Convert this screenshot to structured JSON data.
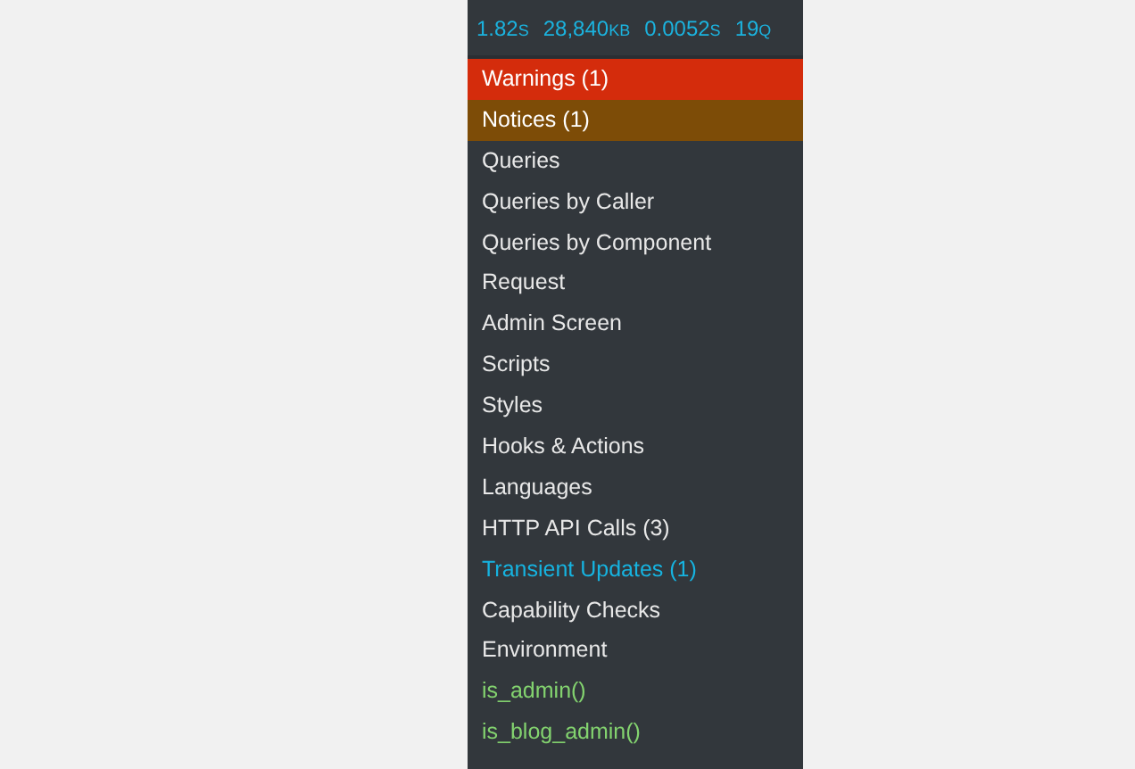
{
  "stats": [
    {
      "value": "1.82",
      "unit": "S"
    },
    {
      "value": "28,840",
      "unit": "KB"
    },
    {
      "value": "0.0052",
      "unit": "S"
    },
    {
      "value": "19",
      "unit": "Q"
    }
  ],
  "menu": [
    {
      "label": "Warnings (1)",
      "kind": "warning"
    },
    {
      "label": "Notices (1)",
      "kind": "notice"
    },
    {
      "label": "Queries",
      "kind": "normal"
    },
    {
      "label": "Queries by Caller",
      "kind": "normal"
    },
    {
      "label": "Queries by Component",
      "kind": "normal"
    },
    {
      "label": "Request",
      "kind": "normal"
    },
    {
      "label": "Admin Screen",
      "kind": "normal"
    },
    {
      "label": "Scripts",
      "kind": "normal"
    },
    {
      "label": "Styles",
      "kind": "normal"
    },
    {
      "label": "Hooks & Actions",
      "kind": "normal"
    },
    {
      "label": "Languages",
      "kind": "normal"
    },
    {
      "label": "HTTP API Calls (3)",
      "kind": "normal"
    },
    {
      "label": "Transient Updates (1)",
      "kind": "info"
    },
    {
      "label": "Capability Checks",
      "kind": "normal"
    },
    {
      "label": "Environment",
      "kind": "normal"
    },
    {
      "label": "is_admin()",
      "kind": "conditional"
    },
    {
      "label": "is_blog_admin()",
      "kind": "conditional"
    }
  ]
}
